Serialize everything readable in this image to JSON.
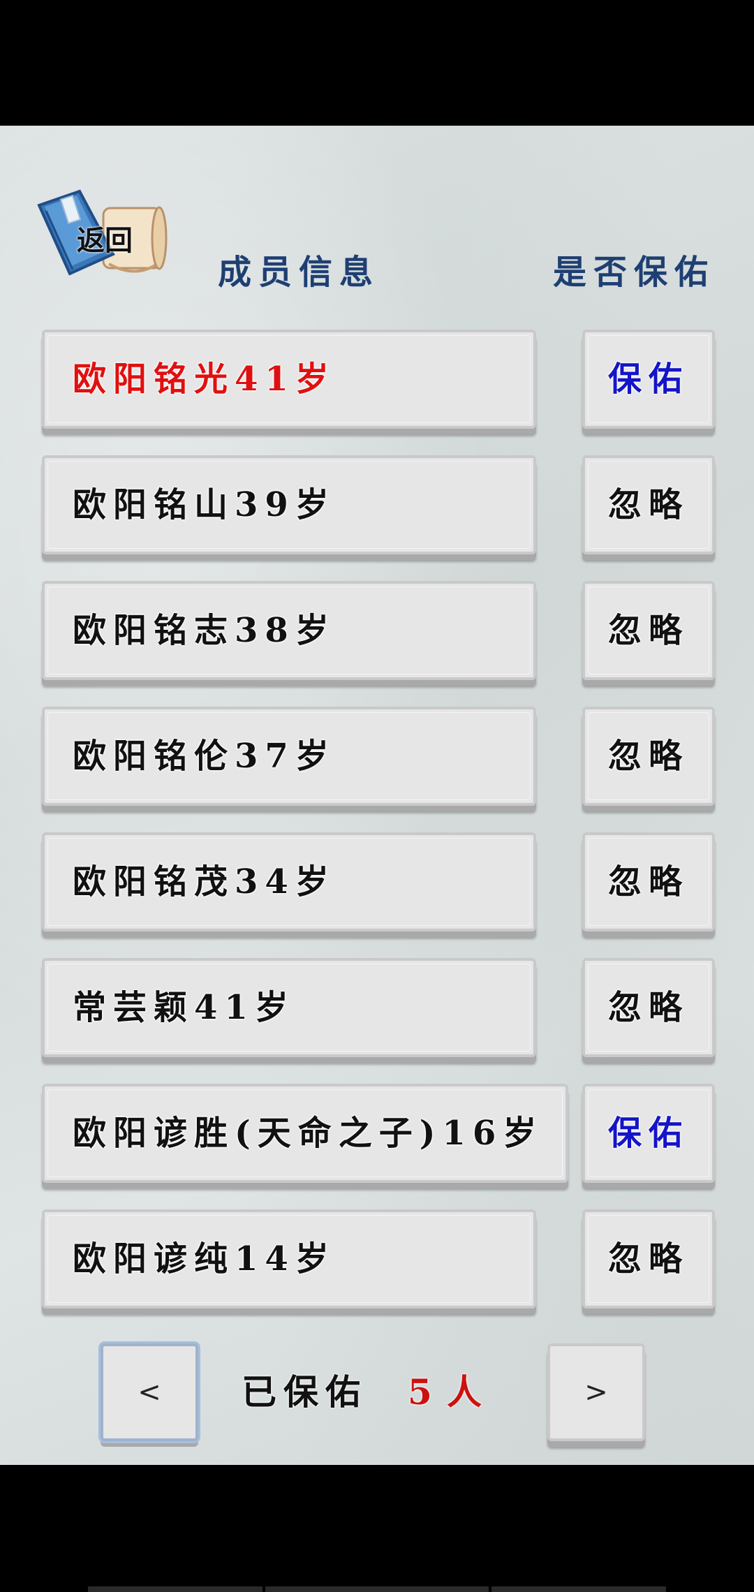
{
  "header": {
    "back_label": "返回",
    "member_info": "成员信息",
    "bless_question": "是否保佑"
  },
  "colors": {
    "blessed_name": "#e01010",
    "status_bless": "#1414c8",
    "status_ignore": "#111111",
    "normal_name": "#111111",
    "header_text": "#1e3f72"
  },
  "members": [
    {
      "name": "欧阳铭光41岁",
      "status": "保佑",
      "highlight": true
    },
    {
      "name": "欧阳铭山39岁",
      "status": "忽略",
      "highlight": false
    },
    {
      "name": "欧阳铭志38岁",
      "status": "忽略",
      "highlight": false
    },
    {
      "name": "欧阳铭伦37岁",
      "status": "忽略",
      "highlight": false
    },
    {
      "name": "欧阳铭茂34岁",
      "status": "忽略",
      "highlight": false
    },
    {
      "name": "常芸颖41岁",
      "status": "忽略",
      "highlight": false
    },
    {
      "name": "欧阳谚胜(天命之子)16岁",
      "status": "保佑",
      "highlight": false
    },
    {
      "name": "欧阳谚纯14岁",
      "status": "忽略",
      "highlight": false
    }
  ],
  "footer": {
    "prev_label": "<",
    "next_label": ">",
    "saved_label": "已保佑",
    "saved_count": "5",
    "saved_unit": "人"
  }
}
